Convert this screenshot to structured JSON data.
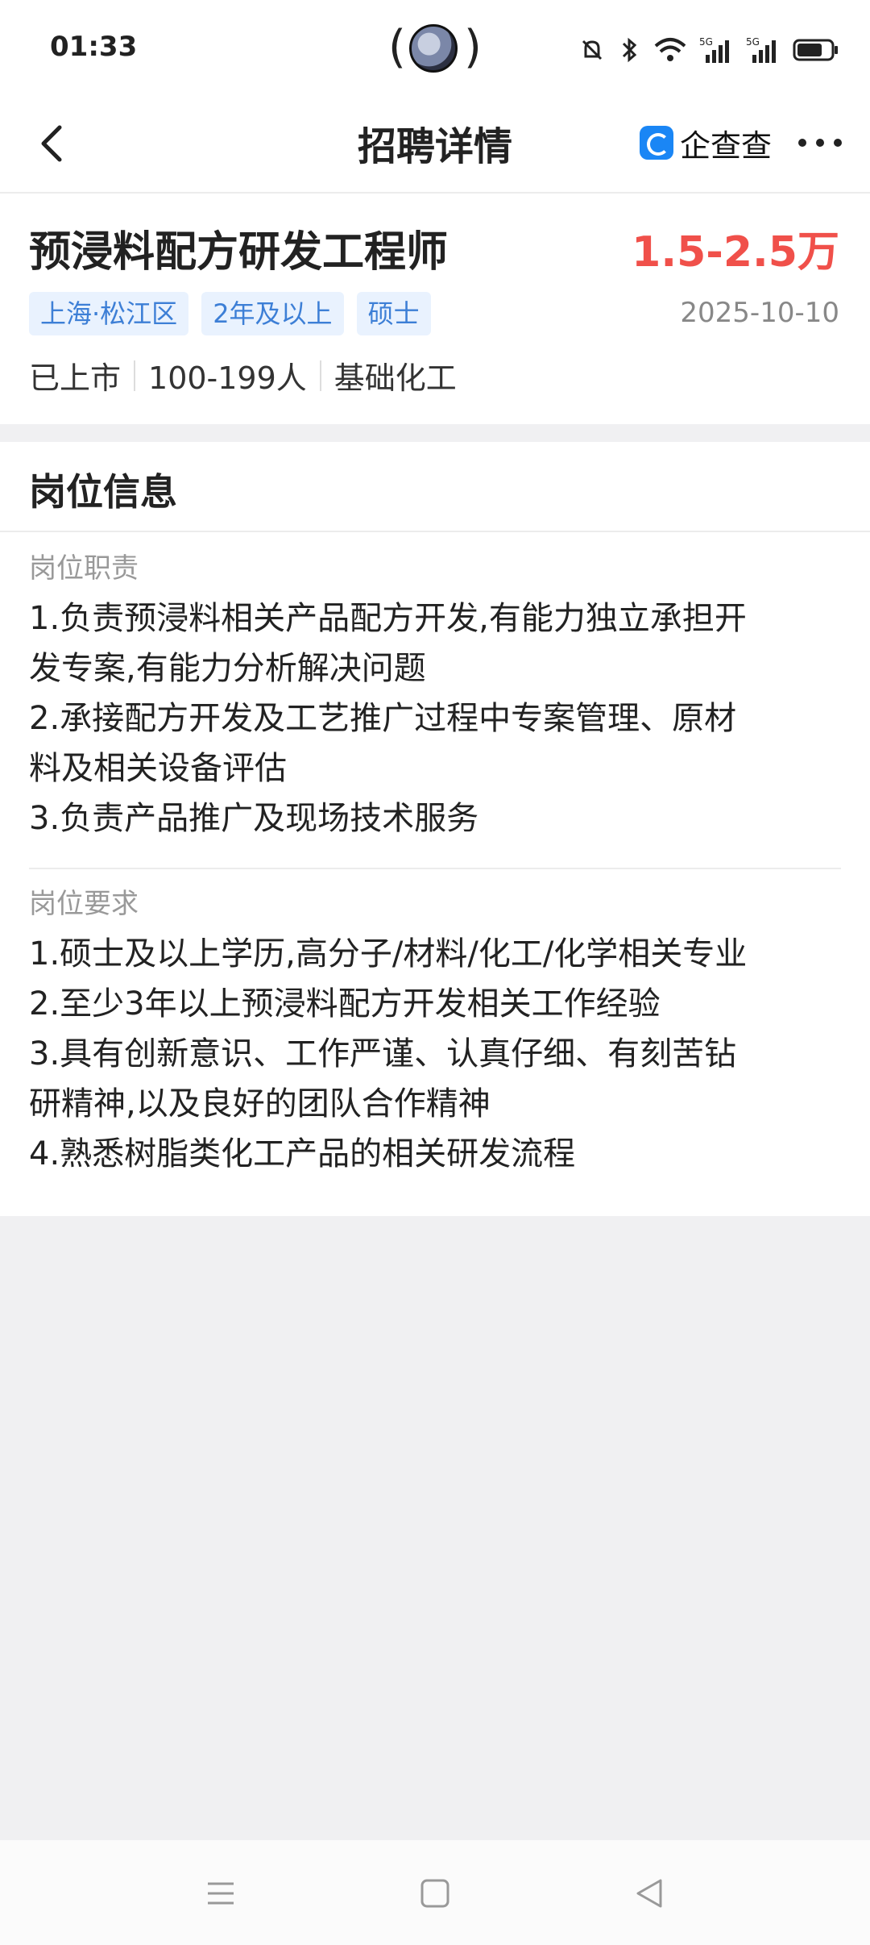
{
  "status_bar": {
    "time": "01:33"
  },
  "nav": {
    "title": "招聘详情",
    "brand": "企查查"
  },
  "job": {
    "title": "预浸料配方研发工程师",
    "salary": "1.5-2.5万",
    "tags": [
      "上海·松江区",
      "2年及以上",
      "硕士"
    ],
    "date": "2025-10-10",
    "company": {
      "listing": "已上市",
      "size": "100-199人",
      "industry": "基础化工"
    }
  },
  "info": {
    "section_title": "岗位信息",
    "duties": {
      "label": "岗位职责",
      "lines": [
        "1.负责预浸料相关产品配方开发,有能力独立承担开",
        "发专案,有能力分析解决问题",
        "2.承接配方开发及工艺推广过程中专案管理、原材",
        "料及相关设备评估",
        "3.负责产品推广及现场技术服务"
      ]
    },
    "requirements": {
      "label": "岗位要求",
      "lines": [
        "1.硕士及以上学历,高分子/材料/化工/化学相关专业",
        "2.至少3年以上预浸料配方开发相关工作经验",
        "3.具有创新意识、工作严谨、认真仔细、有刻苦钻",
        "研精神,以及良好的团队合作精神",
        "4.熟悉树脂类化工产品的相关研发流程"
      ]
    }
  },
  "colors": {
    "salary": "#f0504a",
    "tag_bg": "#e9f2fe",
    "tag_text": "#3d7fd6",
    "brand": "#1a86f5"
  }
}
